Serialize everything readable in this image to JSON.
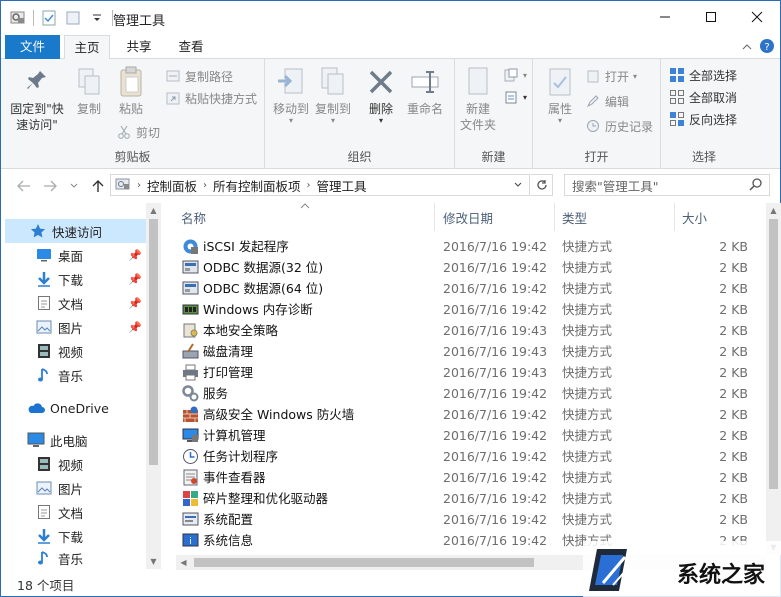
{
  "window": {
    "title": "管理工具"
  },
  "tabs": {
    "file": "文件",
    "home": "主页",
    "share": "共享",
    "view": "查看"
  },
  "ribbon": {
    "clipboard": {
      "label": "剪贴板",
      "pin": "固定到\"快\n速访问\"",
      "copy": "复制",
      "paste": "粘贴",
      "copy_path": "复制路径",
      "paste_shortcut": "粘贴快捷方式",
      "cut": "剪切"
    },
    "organize": {
      "label": "组织",
      "move_to": "移动到",
      "copy_to": "复制到",
      "delete": "删除",
      "rename": "重命名"
    },
    "new": {
      "label": "新建",
      "new_folder": "新建\n文件夹"
    },
    "open": {
      "label": "打开",
      "properties": "属性",
      "open": "打开",
      "edit": "编辑",
      "history": "历史记录"
    },
    "select": {
      "label": "选择",
      "select_all": "全部选择",
      "select_none": "全部取消",
      "invert": "反向选择"
    }
  },
  "address": {
    "crumbs": [
      "控制面板",
      "所有控制面板项",
      "管理工具"
    ]
  },
  "search": {
    "placeholder": "搜索\"管理工具\""
  },
  "nav": {
    "quick_access": "快速访问",
    "items": [
      {
        "label": "桌面",
        "icon": "desktop-icon",
        "pinned": true
      },
      {
        "label": "下载",
        "icon": "download-icon",
        "pinned": true
      },
      {
        "label": "文档",
        "icon": "document-icon",
        "pinned": true
      },
      {
        "label": "图片",
        "icon": "picture-icon",
        "pinned": true
      },
      {
        "label": "视频",
        "icon": "video-icon",
        "pinned": false
      },
      {
        "label": "音乐",
        "icon": "music-icon",
        "pinned": false
      }
    ],
    "onedrive": "OneDrive",
    "this_pc": "此电脑",
    "pc_items": [
      {
        "label": "视频",
        "icon": "video-icon"
      },
      {
        "label": "图片",
        "icon": "picture-icon"
      },
      {
        "label": "文档",
        "icon": "document-icon"
      },
      {
        "label": "下载",
        "icon": "download-icon"
      },
      {
        "label": "音乐",
        "icon": "music-icon"
      }
    ]
  },
  "columns": {
    "name": "名称",
    "date": "修改日期",
    "type": "类型",
    "size": "大小"
  },
  "files": [
    {
      "name": "iSCSI 发起程序",
      "date": "2016/7/16 19:42",
      "type": "快捷方式",
      "size": "2 KB",
      "icon": "iscsi-icon"
    },
    {
      "name": "ODBC 数据源(32 位)",
      "date": "2016/7/16 19:42",
      "type": "快捷方式",
      "size": "2 KB",
      "icon": "odbc-icon"
    },
    {
      "name": "ODBC 数据源(64 位)",
      "date": "2016/7/16 19:42",
      "type": "快捷方式",
      "size": "2 KB",
      "icon": "odbc-icon"
    },
    {
      "name": "Windows 内存诊断",
      "date": "2016/7/16 19:42",
      "type": "快捷方式",
      "size": "2 KB",
      "icon": "memory-diagnostic-icon"
    },
    {
      "name": "本地安全策略",
      "date": "2016/7/16 19:43",
      "type": "快捷方式",
      "size": "2 KB",
      "icon": "security-policy-icon"
    },
    {
      "name": "磁盘清理",
      "date": "2016/7/16 19:43",
      "type": "快捷方式",
      "size": "2 KB",
      "icon": "disk-cleanup-icon"
    },
    {
      "name": "打印管理",
      "date": "2016/7/16 19:43",
      "type": "快捷方式",
      "size": "2 KB",
      "icon": "print-management-icon"
    },
    {
      "name": "服务",
      "date": "2016/7/16 19:42",
      "type": "快捷方式",
      "size": "2 KB",
      "icon": "services-icon"
    },
    {
      "name": "高级安全 Windows 防火墙",
      "date": "2016/7/16 19:42",
      "type": "快捷方式",
      "size": "2 KB",
      "icon": "firewall-icon"
    },
    {
      "name": "计算机管理",
      "date": "2016/7/16 19:42",
      "type": "快捷方式",
      "size": "2 KB",
      "icon": "computer-management-icon"
    },
    {
      "name": "任务计划程序",
      "date": "2016/7/16 19:42",
      "type": "快捷方式",
      "size": "2 KB",
      "icon": "task-scheduler-icon"
    },
    {
      "name": "事件查看器",
      "date": "2016/7/16 19:42",
      "type": "快捷方式",
      "size": "2 KB",
      "icon": "event-viewer-icon"
    },
    {
      "name": "碎片整理和优化驱动器",
      "date": "2016/7/16 19:42",
      "type": "快捷方式",
      "size": "2 KB",
      "icon": "defrag-icon"
    },
    {
      "name": "系统配置",
      "date": "2016/7/16 19:42",
      "type": "快捷方式",
      "size": "2 KB",
      "icon": "system-config-icon"
    },
    {
      "name": "系统信息",
      "date": "2016/7/16 19:42",
      "type": "快捷方式",
      "size": "2 KB",
      "icon": "system-info-icon"
    }
  ],
  "status": {
    "count": "18 个项目"
  },
  "watermark": {
    "text": "系统之家"
  },
  "colors": {
    "accent": "#1979ca",
    "selection": "#cce8ff"
  }
}
